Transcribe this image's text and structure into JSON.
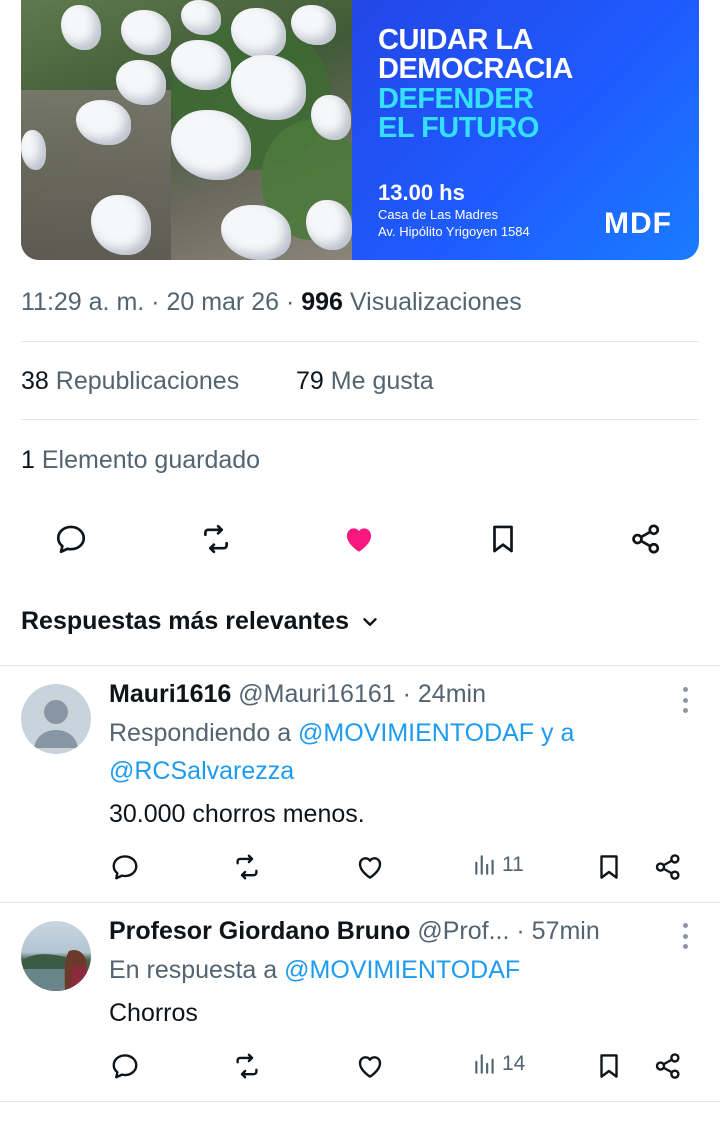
{
  "banner": {
    "headline_1": "CUIDAR LA",
    "headline_2": "DEMOCRACIA",
    "headline_3": "DEFENDER",
    "headline_4": "EL FUTURO",
    "time": "13.00 hs",
    "venue": "Casa de Las Madres",
    "address": "Av. Hipólito Yrigoyen 1584",
    "logo": "MDF",
    "colors": {
      "bg": "#1f5bff",
      "accent": "#35e0ff"
    }
  },
  "post_meta": {
    "time": "11:29 a. m.",
    "sep1": "·",
    "date": "20 mar 26",
    "sep2": "·",
    "views_count": "996",
    "views_label": "Visualizaciones"
  },
  "stats": {
    "reposts_count": "38",
    "reposts_label": "Republicaciones",
    "likes_count": "79",
    "likes_label": "Me gusta",
    "saved_count": "1",
    "saved_label": "Elemento guardado"
  },
  "actions": {
    "icons": [
      "reply-icon",
      "repost-icon",
      "heart-filled-icon",
      "bookmark-icon",
      "share-icon"
    ],
    "like_color": "#f91880"
  },
  "sort": {
    "label": "Respuestas más relevantes"
  },
  "replies": [
    {
      "name": "Mauri1616",
      "handle": "@Mauri16161",
      "sep": "·",
      "time": "24min",
      "context_prefix": "Respondiendo a",
      "mention_1": "@MOVIMIENTODAF",
      "context_join": "y a",
      "mention_2": "@RCSalvarezza",
      "text": "30.000 chorros menos.",
      "views": "11"
    },
    {
      "name": "Profesor Giordano Bruno",
      "handle": "@Prof...",
      "sep": "·",
      "time": "57min",
      "context_prefix": "En respuesta a",
      "mention_1": "@MOVIMIENTODAF",
      "text": "Chorros",
      "views": "14"
    }
  ]
}
